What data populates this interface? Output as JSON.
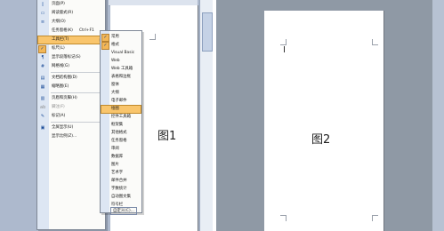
{
  "figures": {
    "left_caption": "图1",
    "right_caption": "图2"
  },
  "menu_view": {
    "items": [
      {
        "label": "页面(P)",
        "icon": "page-icon"
      },
      {
        "label": "阅读版式(R)",
        "icon": "read-layout-icon"
      },
      {
        "label": "大纲(O)",
        "icon": "outline-icon"
      },
      {
        "label": "任务窗格(K)",
        "shortcut": "Ctrl+F1"
      },
      {
        "label": "工具栏(T)",
        "submenu": true,
        "highlighted": true
      },
      {
        "label": "标尺(L)",
        "checked": true
      },
      {
        "label": "显示段落标记(S)",
        "icon": "paragraph-mark-icon"
      },
      {
        "label": "网格线(G)",
        "icon": "grid-icon"
      },
      {
        "label": "文档结构图(D)",
        "icon": "document-map-icon"
      },
      {
        "label": "缩略图(E)",
        "icon": "thumbnail-icon"
      },
      {
        "label": "页眉和页脚(H)",
        "icon": "header-footer-icon"
      },
      {
        "label": "脚注(F)",
        "disabled": true,
        "icon": "footnote-icon"
      },
      {
        "label": "标记(A)",
        "icon": "markup-icon"
      },
      {
        "label": "全屏显示(U)",
        "icon": "fullscreen-icon"
      },
      {
        "label": "显示比例(Z)..."
      }
    ]
  },
  "menu_toolbars": {
    "items": [
      {
        "label": "常用",
        "checked": true
      },
      {
        "label": "格式",
        "checked": true
      },
      {
        "label": "Visual Basic"
      },
      {
        "label": "Web"
      },
      {
        "label": "Web 工具箱"
      },
      {
        "label": "表格和边框"
      },
      {
        "label": "窗体"
      },
      {
        "label": "大纲"
      },
      {
        "label": "电子邮件"
      },
      {
        "label": "绘图",
        "highlighted": true
      },
      {
        "label": "控件工具箱"
      },
      {
        "label": "框架集"
      },
      {
        "label": "其他格式"
      },
      {
        "label": "任务窗格"
      },
      {
        "label": "审阅"
      },
      {
        "label": "数据库"
      },
      {
        "label": "图片"
      },
      {
        "label": "艺术字"
      },
      {
        "label": "邮件合并"
      },
      {
        "label": "字数统计"
      },
      {
        "label": "自动图文集"
      },
      {
        "label": "符号栏"
      },
      {
        "label": "自定义(C)...",
        "boxed": true
      }
    ]
  }
}
